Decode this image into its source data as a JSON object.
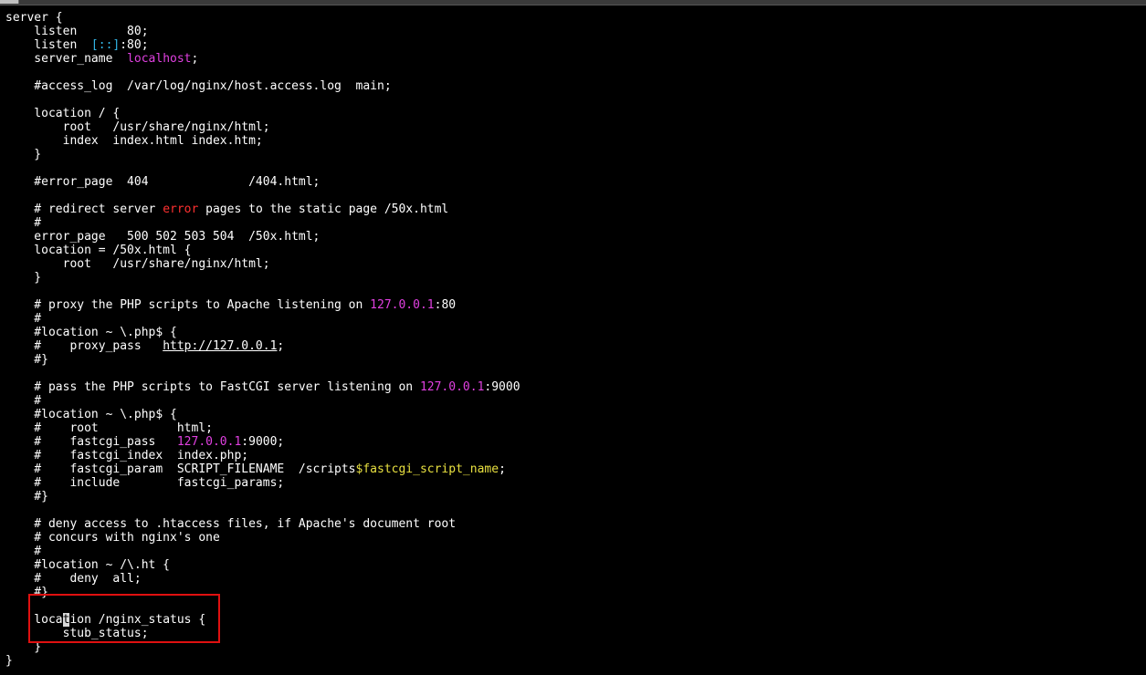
{
  "editor": {
    "lines": [
      {
        "t": "server {"
      },
      {
        "t": "    listen       80;"
      },
      {
        "t": "    listen  ",
        "spans": [
          {
            "c": "cyan",
            "t": "[::]"
          },
          {
            "t": ":80;"
          }
        ]
      },
      {
        "t": "    server_name  ",
        "spans": [
          {
            "c": "magenta",
            "t": "localhost"
          },
          {
            "t": ";"
          }
        ]
      },
      {
        "t": ""
      },
      {
        "t": "    #access_log  /var/log/nginx/host.access.log  main;"
      },
      {
        "t": ""
      },
      {
        "t": "    location / {"
      },
      {
        "t": "        root   /usr/share/nginx/html;"
      },
      {
        "t": "        index  index.html index.htm;"
      },
      {
        "t": "    }"
      },
      {
        "t": ""
      },
      {
        "t": "    #error_page  404              /404.html;"
      },
      {
        "t": ""
      },
      {
        "t": "    # redirect server ",
        "spans": [
          {
            "c": "red",
            "t": "error"
          },
          {
            "t": " pages to the static page /50x.html"
          }
        ]
      },
      {
        "t": "    #"
      },
      {
        "t": "    error_page   500 502 503 504  /50x.html;"
      },
      {
        "t": "    location = /50x.html {"
      },
      {
        "t": "        root   /usr/share/nginx/html;"
      },
      {
        "t": "    }"
      },
      {
        "t": ""
      },
      {
        "t": "    # proxy the PHP scripts to Apache listening on ",
        "spans": [
          {
            "c": "magenta",
            "t": "127.0.0.1"
          },
          {
            "t": ":80"
          }
        ]
      },
      {
        "t": "    #"
      },
      {
        "t": "    #location ~ \\.php$ {"
      },
      {
        "t": "    #    proxy_pass   ",
        "spans": [
          {
            "c": "url",
            "t": "http://127.0.0.1"
          },
          {
            "t": ";"
          }
        ]
      },
      {
        "t": "    #}"
      },
      {
        "t": ""
      },
      {
        "t": "    # pass the PHP scripts to FastCGI server listening on ",
        "spans": [
          {
            "c": "magenta",
            "t": "127.0.0.1"
          },
          {
            "t": ":9000"
          }
        ]
      },
      {
        "t": "    #"
      },
      {
        "t": "    #location ~ \\.php$ {"
      },
      {
        "t": "    #    root           html;"
      },
      {
        "t": "    #    fastcgi_pass   ",
        "spans": [
          {
            "c": "magenta",
            "t": "127.0.0.1"
          },
          {
            "t": ":9000;"
          }
        ]
      },
      {
        "t": "    #    fastcgi_index  index.php;"
      },
      {
        "t": "    #    fastcgi_param  SCRIPT_FILENAME  /scripts",
        "spans": [
          {
            "c": "yellow",
            "t": "$fastcgi_script_name"
          },
          {
            "t": ";"
          }
        ]
      },
      {
        "t": "    #    include        fastcgi_params;"
      },
      {
        "t": "    #}"
      },
      {
        "t": ""
      },
      {
        "t": "    # deny access to .htaccess files, if Apache's document root"
      },
      {
        "t": "    # concurs with nginx's one"
      },
      {
        "t": "    #"
      },
      {
        "t": "    #location ~ /\\.ht {"
      },
      {
        "t": "    #    deny  all;"
      },
      {
        "t": "    #}"
      },
      {
        "t": ""
      },
      {
        "t": "    loca",
        "spans": [
          {
            "c": "cursor",
            "t": "t"
          },
          {
            "t": "ion /nginx_status {"
          }
        ]
      },
      {
        "t": "        stub_status;"
      },
      {
        "t": "    }"
      },
      {
        "t": "}"
      }
    ]
  },
  "colors": {
    "background": "#000000",
    "text": "#ffffff",
    "string": "#e040e0",
    "error_keyword": "#ff3030",
    "ipv6": "#33b5e5",
    "variable": "#e8e040",
    "highlight_box": "#e01010"
  }
}
